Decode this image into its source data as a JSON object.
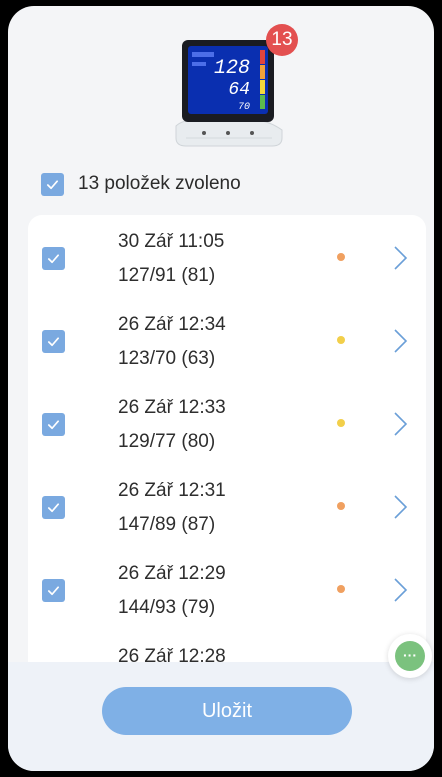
{
  "device": {
    "badge_count": "13",
    "screen_sys": "128",
    "screen_dia": "64",
    "screen_pulse": "70"
  },
  "selection": {
    "label": "13 položek zvoleno"
  },
  "records": [
    {
      "date": "30 Zář 11:05",
      "values": "127/91 (81)",
      "level_color": "#f0a060"
    },
    {
      "date": "26 Zář 12:34",
      "values": "123/70 (63)",
      "level_color": "#f2cf4a"
    },
    {
      "date": "26 Zář 12:33",
      "values": "129/77 (80)",
      "level_color": "#f2cf4a"
    },
    {
      "date": "26 Zář 12:31",
      "values": "147/89 (87)",
      "level_color": "#f0a060"
    },
    {
      "date": "26 Zář 12:29",
      "values": "144/93 (79)",
      "level_color": "#f0a060"
    },
    {
      "date": "26 Zář 12:28",
      "values": "",
      "level_color": ""
    }
  ],
  "footer": {
    "save_label": "Uložit"
  },
  "fab": {
    "icon": "more-dots-icon",
    "label": "···"
  },
  "colors": {
    "accent": "#7fb0e6",
    "checkbox": "#7aa9e0",
    "badge": "#e35050"
  }
}
